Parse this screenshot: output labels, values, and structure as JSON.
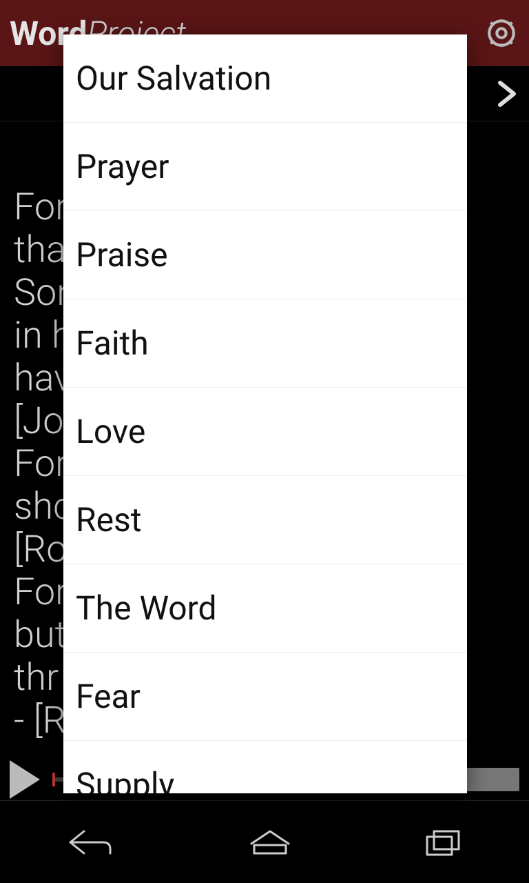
{
  "appbar": {
    "title_part1": "Word",
    "title_part2": "Project"
  },
  "content_text": "For\ntha                                     n\nSon                                    h\nin h\nhav\n[Jo\nFor                                     e\nshc\n[Ro\nFor                                   ;\nbut                                  life\nthr                                   d.\n- [R",
  "modal": {
    "items": [
      "Our Salvation",
      "Prayer",
      "Praise",
      "Faith",
      "Love",
      "Rest",
      "The Word",
      "Fear",
      "Supply"
    ]
  }
}
